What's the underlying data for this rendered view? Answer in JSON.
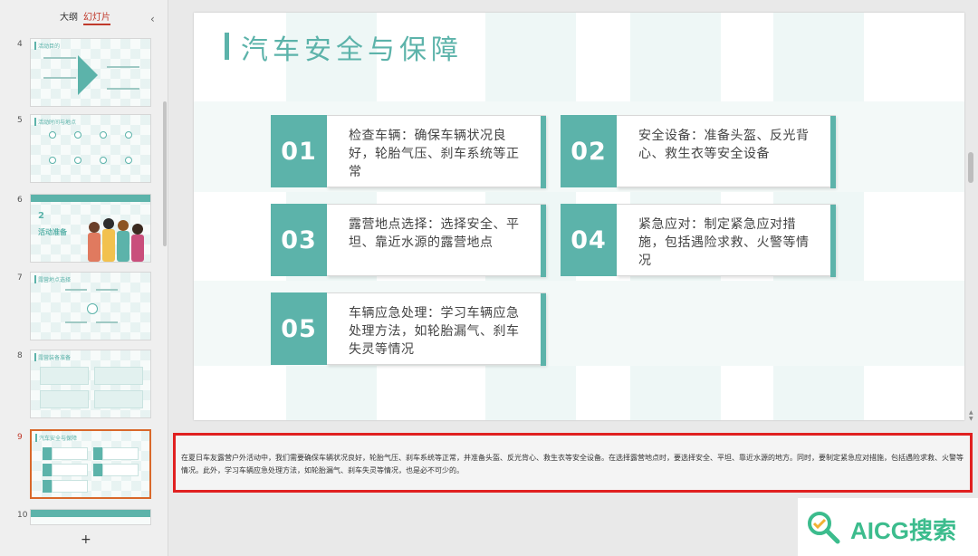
{
  "left_panel": {
    "tabs": {
      "outline": "大纲",
      "slides": "幻灯片"
    },
    "thumbnails": [
      {
        "num": "4",
        "title": "活动目的"
      },
      {
        "num": "5",
        "title": "活动时间与地点"
      },
      {
        "num": "6",
        "section_num": "2",
        "section_title": "活动准备"
      },
      {
        "num": "7",
        "title": "露营地点选择"
      },
      {
        "num": "8",
        "title": "露营装备准备"
      },
      {
        "num": "9",
        "title": "汽车安全与保障",
        "active": true
      },
      {
        "num": "10"
      }
    ],
    "add_slide": "+"
  },
  "slide": {
    "title": "汽车安全与保障",
    "accent_color": "#5cb3aa",
    "cards": [
      {
        "num": "01",
        "text": "检查车辆：确保车辆状况良好，轮胎气压、刹车系统等正常"
      },
      {
        "num": "02",
        "text": "安全设备：准备头盔、反光背心、救生衣等安全设备"
      },
      {
        "num": "03",
        "text": "露营地点选择：选择安全、平坦、靠近水源的露营地点"
      },
      {
        "num": "04",
        "text": "紧急应对：制定紧急应对措施，包括遇险求救、火警等情况"
      },
      {
        "num": "05",
        "text": "车辆应急处理：学习车辆应急处理方法，如轮胎漏气、刹车失灵等情况"
      }
    ]
  },
  "notes": {
    "text": "在夏日车友露营户外活动中，我们需要确保车辆状况良好，轮胎气压、刹车系统等正常，并准备头盔、反光背心、救生衣等安全设备。在选择露营地点时，要选择安全、平坦、靠近水源的地方。同时，要制定紧急应对措施，包括遇险求救、火警等情况。此外，学习车辆应急处理方法，如轮胎漏气、刹车失灵等情况，也是必不可少的。",
    "highlight_color": "#e02020"
  },
  "watermark": {
    "text": "AICG搜索"
  }
}
